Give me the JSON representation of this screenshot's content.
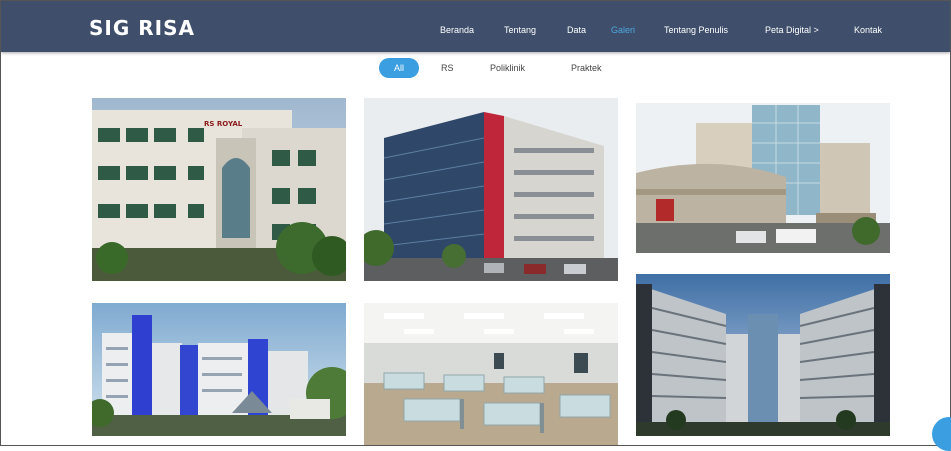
{
  "brand": "SIG RISA",
  "nav": {
    "items": [
      {
        "label": "Beranda"
      },
      {
        "label": "Tentang"
      },
      {
        "label": "Data"
      },
      {
        "label": "Galeri"
      },
      {
        "label": "Tentang Penulis"
      },
      {
        "label": "Peta Digital >"
      },
      {
        "label": "Kontak"
      }
    ],
    "active": "Galeri"
  },
  "filters": {
    "items": [
      {
        "label": "All"
      },
      {
        "label": "RS"
      },
      {
        "label": "Poliklinik"
      },
      {
        "label": "Praktek"
      }
    ],
    "active": "All"
  },
  "gallery": {
    "item_count": 6,
    "photo_sign": "RS ROYAL"
  },
  "colors": {
    "navbar": "#3f4f6b",
    "accent": "#3a9ee0"
  }
}
